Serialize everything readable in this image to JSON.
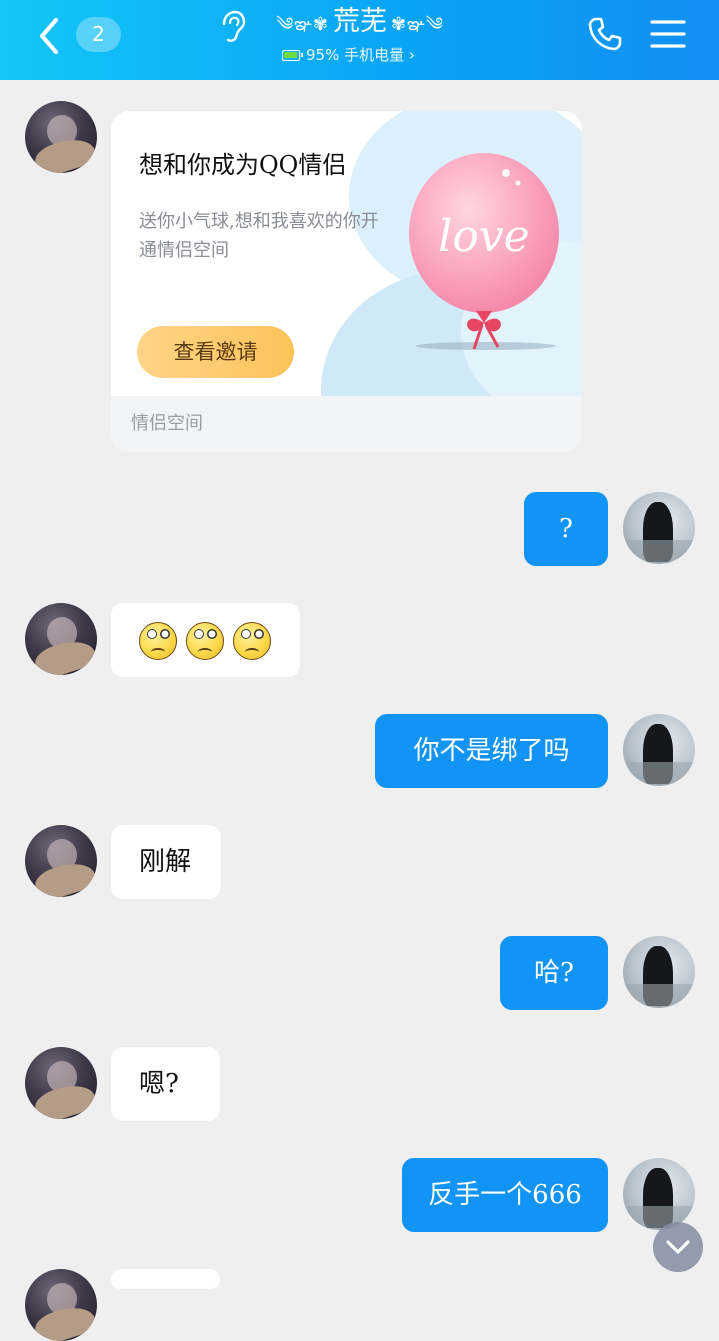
{
  "header": {
    "unread_count": "2",
    "title_left_deco": "༄ఞ✾",
    "title": "荒芜",
    "title_right_deco": "✾ఞ༄",
    "status": "95% 手机电量 ›",
    "accent_color": "#0aa5f5"
  },
  "card": {
    "title": "想和你成为QQ情侣",
    "description": "送你小气球,想和我喜欢的你开通情侣空间",
    "button_label": "查看邀请",
    "balloon_text": "love",
    "footer": "情侣空间"
  },
  "messages": [
    {
      "side": "out",
      "text": "?"
    },
    {
      "side": "in",
      "emoji_count": 3,
      "emoji": "roll-eyes-emoji"
    },
    {
      "side": "out",
      "text": "你不是绑了吗"
    },
    {
      "side": "in",
      "text": "刚解"
    },
    {
      "side": "out",
      "text": "哈?"
    },
    {
      "side": "in",
      "text": "嗯?"
    },
    {
      "side": "out",
      "text": "反手一个666"
    }
  ]
}
